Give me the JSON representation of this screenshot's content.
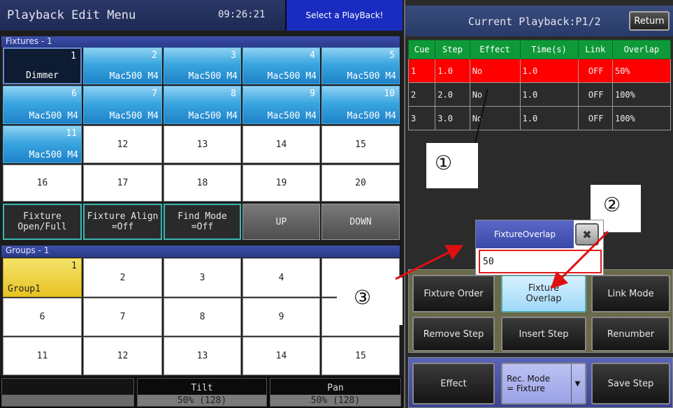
{
  "left": {
    "title": "Playback Edit Menu",
    "time": "09:26:21",
    "status": "Select a PlayBack!",
    "fixtures_header": "Fixtures - 1",
    "fixtures": [
      {
        "num": "1",
        "name": "Dimmer",
        "style": "dark"
      },
      {
        "num": "2",
        "name": "Mac500 M4",
        "style": "blue"
      },
      {
        "num": "3",
        "name": "Mac500 M4",
        "style": "blue"
      },
      {
        "num": "4",
        "name": "Mac500 M4",
        "style": "blue"
      },
      {
        "num": "5",
        "name": "Mac500 M4",
        "style": "blue"
      },
      {
        "num": "6",
        "name": "Mac500 M4",
        "style": "blue"
      },
      {
        "num": "7",
        "name": "Mac500 M4",
        "style": "blue"
      },
      {
        "num": "8",
        "name": "Mac500 M4",
        "style": "blue"
      },
      {
        "num": "9",
        "name": "Mac500 M4",
        "style": "blue"
      },
      {
        "num": "10",
        "name": "Mac500 M4",
        "style": "blue"
      },
      {
        "num": "11",
        "name": "Mac500 M4",
        "style": "blue"
      },
      {
        "num": "12",
        "name": "",
        "style": "white"
      },
      {
        "num": "13",
        "name": "",
        "style": "white"
      },
      {
        "num": "14",
        "name": "",
        "style": "white"
      },
      {
        "num": "15",
        "name": "",
        "style": "white"
      },
      {
        "num": "16",
        "name": "",
        "style": "white"
      },
      {
        "num": "17",
        "name": "",
        "style": "white"
      },
      {
        "num": "18",
        "name": "",
        "style": "white"
      },
      {
        "num": "19",
        "name": "",
        "style": "white"
      },
      {
        "num": "20",
        "name": "",
        "style": "white"
      }
    ],
    "fixture_buttons": [
      {
        "line1": "Fixture",
        "line2": "Open/Full"
      },
      {
        "line1": "Fixture Align",
        "line2": "=Off"
      },
      {
        "line1": "Find Mode",
        "line2": "=Off"
      },
      {
        "line1": "UP",
        "line2": ""
      },
      {
        "line1": "DOWN",
        "line2": ""
      }
    ],
    "groups_header": "Groups - 1",
    "groups": [
      {
        "num": "1",
        "name": "Group1",
        "style": "yellow"
      },
      {
        "num": "2",
        "name": ""
      },
      {
        "num": "3",
        "name": ""
      },
      {
        "num": "4",
        "name": ""
      },
      {
        "num": "",
        "name": ""
      },
      {
        "num": "6",
        "name": ""
      },
      {
        "num": "7",
        "name": ""
      },
      {
        "num": "8",
        "name": ""
      },
      {
        "num": "9",
        "name": ""
      },
      {
        "num": "",
        "name": ""
      },
      {
        "num": "11",
        "name": ""
      },
      {
        "num": "12",
        "name": ""
      },
      {
        "num": "13",
        "name": ""
      },
      {
        "num": "14",
        "name": ""
      },
      {
        "num": "15",
        "name": ""
      }
    ],
    "bottom": {
      "tilt_label": "Tilt",
      "tilt_value": "50% (128)",
      "pan_label": "Pan",
      "pan_value": "50% (128)"
    }
  },
  "right": {
    "title": "Current Playback:P1/2",
    "return_label": "Return",
    "columns": [
      "Cue",
      "Step",
      "Effect",
      "Time(s)",
      "Link",
      "Overlap"
    ],
    "rows": [
      [
        "1",
        "1.0",
        "No",
        "1.0",
        "OFF",
        "50%"
      ],
      [
        "2",
        "2.0",
        "No",
        "1.0",
        "OFF",
        "100%"
      ],
      [
        "3",
        "3.0",
        "No",
        "1.0",
        "OFF",
        "100%"
      ]
    ],
    "dialog": {
      "title": "FixtureOverlap",
      "value": "50",
      "close": "✖"
    },
    "buttons": {
      "fixture_order": "Fixture Order",
      "fixture_overlap_1": "Fixture",
      "fixture_overlap_2": "Overlap",
      "link_mode": "Link Mode",
      "remove_step": "Remove Step",
      "insert_step": "Insert Step",
      "renumber": "Renumber",
      "effect": "Effect",
      "rec_mode_1": "Rec. Mode",
      "rec_mode_2": "= Fixture",
      "save_step": "Save Step"
    }
  },
  "annotations": {
    "a1": "①",
    "a2": "②",
    "a3": "③"
  },
  "colors": {
    "selected_row": "#ff0000",
    "table_header": "#0f9a3a",
    "fixture_blue": "#3aa6e0",
    "group_selected": "#e7c423",
    "arrow": "#e01010"
  }
}
